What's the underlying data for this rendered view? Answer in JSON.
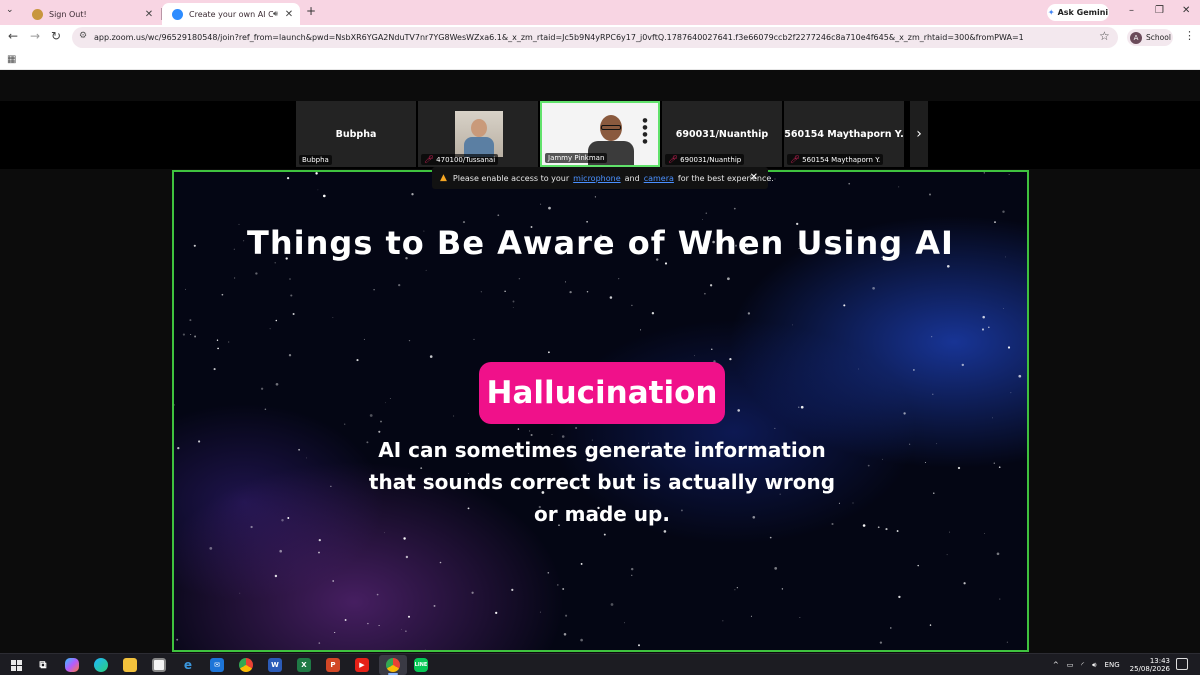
{
  "browser": {
    "tabs": [
      {
        "title": "Sign Out!",
        "favicon_color": "#c8963e"
      },
      {
        "title": "Create your own AI Chatbot",
        "favicon_color": "#2d8cff"
      }
    ],
    "new_tab": "+",
    "ask_gemini": "Ask Gemini",
    "window_controls": [
      "–",
      "❐",
      "✕"
    ],
    "url": "app.zoom.us/wc/96529180548/join?ref_from=launch&pwd=NsbXR6YGA2NduTV7nr7YG8WesWZxa6.1&_x_zm_rtaid=Jc5b9N4yRPC6y17_j0vftQ.1787640027641.f3e66079ccb2f2277246c8a710e4f645&_x_zm_rhtaid=300&fromPWA=1",
    "profile": {
      "initial": "A",
      "label": "School"
    }
  },
  "participants": [
    {
      "name_display": "Bubpha",
      "label": "Bubpha",
      "muted": false,
      "video": false
    },
    {
      "name_display": "",
      "label": "470100/Tussanai",
      "muted": true,
      "video": true
    },
    {
      "name_display": "",
      "label": "Jammy Pinkman",
      "muted": false,
      "video": true,
      "active_speaker": true
    },
    {
      "name_display": "690031/Nuanthip",
      "label": "690031/Nuanthip",
      "muted": true,
      "video": false
    },
    {
      "name_display": "560154 Maythaporn Y.",
      "label": "560154 Maythaporn Y.",
      "muted": true,
      "video": false
    }
  ],
  "notice": {
    "prefix": "Please enable access to your",
    "link1": "microphone",
    "mid": "and",
    "link2": "camera",
    "suffix": "for the best experience."
  },
  "slide": {
    "title": "Things to Be Aware of When Using AI",
    "pill": "Hallucination",
    "body_lines": [
      "AI can sometimes generate information",
      "that sounds correct but is actually wrong",
      "or made up."
    ],
    "pill_color": "#f0118a"
  },
  "taskbar": {
    "language": "ENG",
    "time": "13:43",
    "date": "25/08/2026"
  }
}
